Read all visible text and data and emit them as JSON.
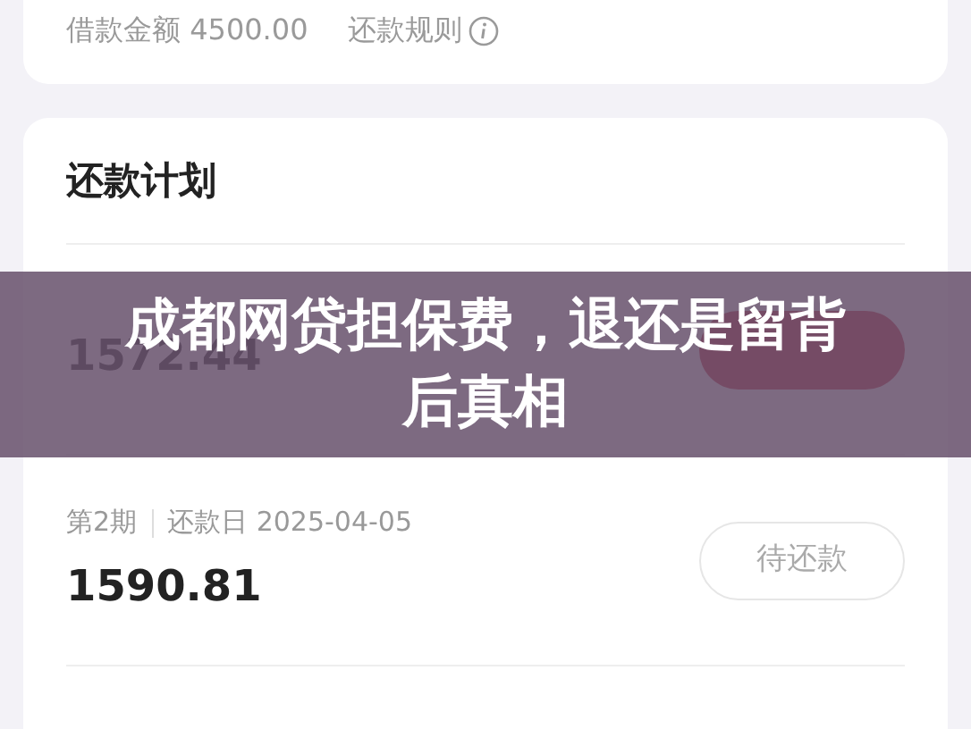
{
  "loan_summary": {
    "amount_label": "借款金额 4500.00",
    "rules_link": "还款规则"
  },
  "plan": {
    "title": "还款计划",
    "installments": [
      {
        "amount": "1572.44",
        "button": {
          "kind": "primary"
        }
      },
      {
        "period": "第2期",
        "due": "还款日 2025-04-05",
        "amount": "1590.81",
        "button": {
          "kind": "pending",
          "label": "待还款"
        }
      }
    ]
  },
  "overlay_title_lines": [
    "成都网贷担保费，退还是留背",
    "后真相"
  ]
}
